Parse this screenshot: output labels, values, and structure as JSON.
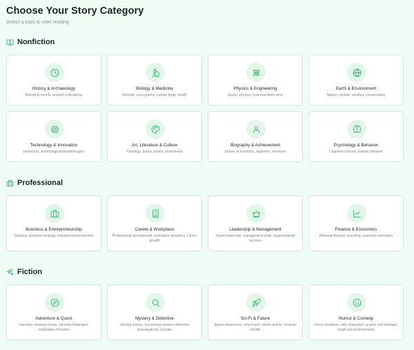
{
  "header": {
    "title": "Choose Your Story Category",
    "subtitle": "Select a topic to start reading"
  },
  "colors": {
    "accent": "#34b872",
    "background": "#effcf5",
    "icon_bg": "#e2f7ea",
    "card_border": "#cfe8da"
  },
  "sections": [
    {
      "title": "Nonfiction",
      "icon": "book-open-icon",
      "cards": [
        {
          "title": "History & Archaeology",
          "desc": "Historical events, ancient civilizations",
          "icon": "clock-icon"
        },
        {
          "title": "Biology & Medicine",
          "desc": "Animals, ecosystems, human body, health",
          "icon": "microscope-icon"
        },
        {
          "title": "Physics & Engineering",
          "desc": "Space, physics, how machines work",
          "icon": "atom-icon"
        },
        {
          "title": "Earth & Environment",
          "desc": "Nature, climate, weather, conservation",
          "icon": "globe-icon"
        },
        {
          "title": "Technology & Innovation",
          "desc": "Inventions, technological breakthroughs",
          "icon": "chip-icon"
        },
        {
          "title": "Art, Literature & Culture",
          "desc": "Paintings, books, artists, movements",
          "icon": "palette-icon"
        },
        {
          "title": "Biography & Achievement",
          "desc": "Stories of scientists, explorers, inventors",
          "icon": "user-icon"
        },
        {
          "title": "Psychology & Behavior",
          "desc": "Cognitive science, human behavior",
          "icon": "brain-icon"
        }
      ]
    },
    {
      "title": "Professional",
      "icon": "briefcase-icon",
      "cards": [
        {
          "title": "Business & Entrepreneurship",
          "desc": "Startups, business strategy, entrepreneurial mindset",
          "icon": "briefcase-icon"
        },
        {
          "title": "Career & Workplace",
          "desc": "Professional development, workplace dynamics, career growth",
          "icon": "building-icon"
        },
        {
          "title": "Leadership & Management",
          "desc": "Team leadership, management skills, organizational success",
          "icon": "crown-icon"
        },
        {
          "title": "Finance & Economics",
          "desc": "Personal finance, investing, economic principles",
          "icon": "line-chart-icon"
        }
      ]
    },
    {
      "title": "Fiction",
      "icon": "sparkles-icon",
      "cards": [
        {
          "title": "Adventure & Quest",
          "desc": "Journeys, treasure hunts, survival challenges, exploration missions",
          "icon": "compass-icon"
        },
        {
          "title": "Mystery & Detective",
          "desc": "Solving crimes, uncovering secrets, detective investigations, puzzles",
          "icon": "search-icon"
        },
        {
          "title": "Sci-Fi & Future",
          "desc": "Space adventures, time travel, robots and AI, futuristic worlds",
          "icon": "rocket-icon"
        },
        {
          "title": "Humor & Comedy",
          "desc": "Funny situations, silly characters, pranks and mishaps, laugh-out-loud moments",
          "icon": "smile-icon"
        }
      ]
    }
  ]
}
